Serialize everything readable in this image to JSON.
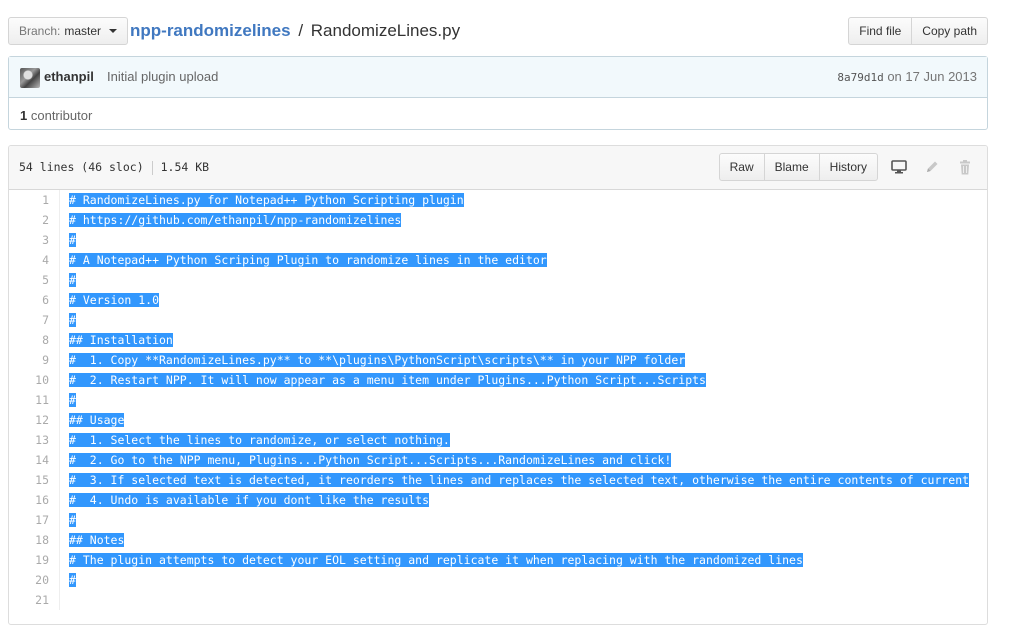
{
  "branch": {
    "prefix": "Branch:",
    "name": "master"
  },
  "breadcrumb": {
    "repo": "npp-randomizelines",
    "separator": "/",
    "file": "RandomizeLines.py"
  },
  "toolbar": {
    "find_file": "Find file",
    "copy_path": "Copy path"
  },
  "commit": {
    "author": "ethanpil",
    "message": "Initial plugin upload",
    "sha": "8a79d1d",
    "date_prefix": "on",
    "date": "17 Jun 2013"
  },
  "contributors": {
    "count": "1",
    "label": "contributor"
  },
  "file_header": {
    "lines": "54 lines (46 sloc)",
    "size": "1.54 KB",
    "raw": "Raw",
    "blame": "Blame",
    "history": "History",
    "icons": [
      "desktop-icon",
      "pencil-icon",
      "trash-icon"
    ]
  },
  "colors": {
    "accent": "#4078c0",
    "selection": "#3297fd",
    "commit_bg": "#f2f9fc"
  },
  "code": {
    "lines": [
      {
        "n": "1",
        "text": "# RandomizeLines.py for Notepad++ Python Scripting plugin"
      },
      {
        "n": "2",
        "text": "# https://github.com/ethanpil/npp-randomizelines"
      },
      {
        "n": "3",
        "text": "#"
      },
      {
        "n": "4",
        "text": "# A Notepad++ Python Scriping Plugin to randomize lines in the editor"
      },
      {
        "n": "5",
        "text": "#"
      },
      {
        "n": "6",
        "text": "# Version 1.0"
      },
      {
        "n": "7",
        "text": "#"
      },
      {
        "n": "8",
        "text": "## Installation"
      },
      {
        "n": "9",
        "text": "#  1. Copy **RandomizeLines.py** to **\\plugins\\PythonScript\\scripts\\** in your NPP folder"
      },
      {
        "n": "10",
        "text": "#  2. Restart NPP. It will now appear as a menu item under Plugins...Python Script...Scripts"
      },
      {
        "n": "11",
        "text": "#"
      },
      {
        "n": "12",
        "text": "## Usage"
      },
      {
        "n": "13",
        "text": "#  1. Select the lines to randomize, or select nothing."
      },
      {
        "n": "14",
        "text": "#  2. Go to the NPP menu, Plugins...Python Script...Scripts...RandomizeLines and click!"
      },
      {
        "n": "15",
        "text": "#  3. If selected text is detected, it reorders the lines and replaces the selected text, otherwise the entire contents of current"
      },
      {
        "n": "16",
        "text": "#  4. Undo is available if you dont like the results"
      },
      {
        "n": "17",
        "text": "#"
      },
      {
        "n": "18",
        "text": "## Notes"
      },
      {
        "n": "19",
        "text": "# The plugin attempts to detect your EOL setting and replicate it when replacing with the randomized lines"
      },
      {
        "n": "20",
        "text": "#"
      },
      {
        "n": "21",
        "text": ""
      }
    ]
  }
}
